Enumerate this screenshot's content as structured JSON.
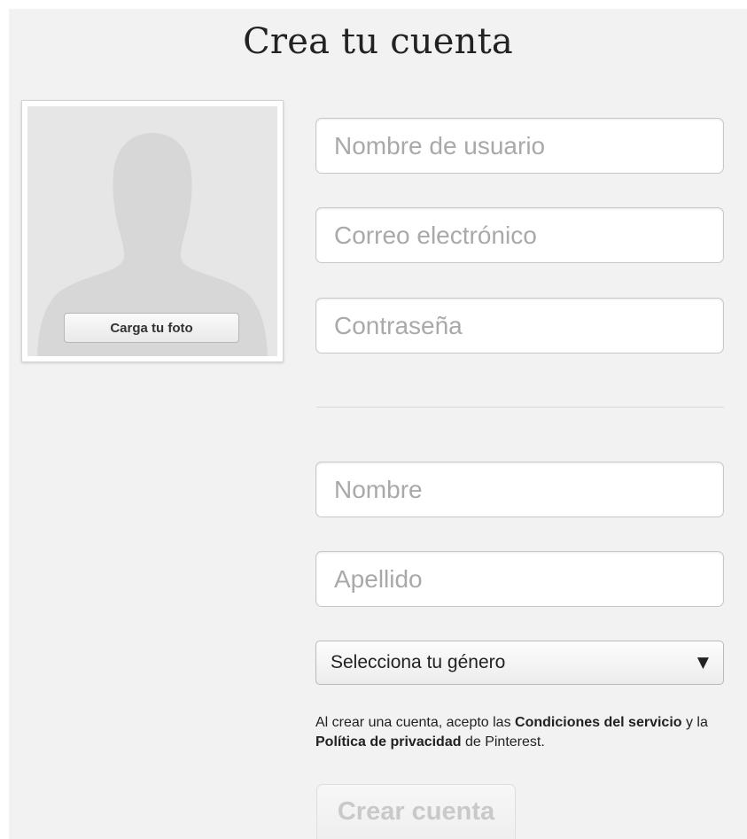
{
  "header": {
    "title": "Crea tu cuenta"
  },
  "photo": {
    "upload_label": "Carga tu foto",
    "icon": "default-avatar-silhouette"
  },
  "form": {
    "username": {
      "placeholder": "Nombre de usuario",
      "value": ""
    },
    "email": {
      "placeholder": "Correo electrónico",
      "value": ""
    },
    "password": {
      "placeholder": "Contraseña",
      "value": ""
    },
    "first_name": {
      "placeholder": "Nombre",
      "value": ""
    },
    "last_name": {
      "placeholder": "Apellido",
      "value": ""
    },
    "gender_select": {
      "selected": "Selecciona tu género",
      "arrow_icon": "triangle-down"
    }
  },
  "terms": {
    "prefix": "Al crear una cuenta, acepto las ",
    "tos_link": "Condiciones del servicio",
    "middle": " y la ",
    "privacy_link": "Política de privacidad",
    "suffix": " de Pinterest."
  },
  "submit": {
    "label": "Crear cuenta",
    "disabled": true
  },
  "colors": {
    "page_background": "#f2f2f2",
    "placeholder": "#a9a9a9",
    "disabled_text": "#c9c9c9",
    "avatar_fill": "#d7d7d7"
  }
}
